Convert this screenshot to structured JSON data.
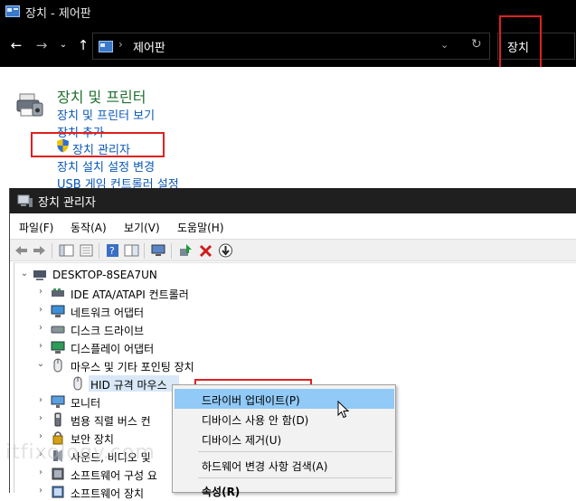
{
  "control_panel": {
    "title": "장치 - 제어판",
    "breadcrumb": "제어판",
    "search_value": "장치",
    "heading": "장치 및 프린터",
    "links": [
      "장치 및 프린터 보기",
      "장치 추가",
      "장치 관리자",
      "장치 설치 설정 변경",
      "USB 게임 컨트롤러 설정"
    ]
  },
  "device_manager": {
    "title": "장치 관리자",
    "menu": [
      "파일(F)",
      "동작(A)",
      "보기(V)",
      "도움말(H)"
    ],
    "tree": {
      "root": "DESKTOP-8SEA7UN",
      "items": [
        {
          "label": "IDE ATA/ATAPI 컨트롤러",
          "icon": "ide-controller-icon",
          "expanded": false
        },
        {
          "label": "네트워크 어댑터",
          "icon": "network-adapter-icon",
          "expanded": false
        },
        {
          "label": "디스크 드라이브",
          "icon": "disk-drive-icon",
          "expanded": false
        },
        {
          "label": "디스플레이 어댑터",
          "icon": "display-adapter-icon",
          "expanded": false
        },
        {
          "label": "마우스 및 기타 포인팅 장치",
          "icon": "mouse-icon",
          "expanded": true
        },
        {
          "label": "HID 규격 마우스",
          "icon": "mouse-icon",
          "child": true,
          "selected": true
        },
        {
          "label": "모니터",
          "icon": "monitor-icon",
          "expanded": false
        },
        {
          "label": "범용 직렬 버스 컨",
          "icon": "usb-icon",
          "expanded": false
        },
        {
          "label": "보안 장치",
          "icon": "security-device-icon",
          "expanded": false
        },
        {
          "label": "사운드, 비디오 및",
          "icon": "sound-icon",
          "expanded": false
        },
        {
          "label": "소프트웨어 구성 요",
          "icon": "software-component-icon",
          "expanded": false
        },
        {
          "label": "소프트웨어 장치",
          "icon": "software-device-icon",
          "expanded": false
        }
      ]
    },
    "context_menu": [
      "드라이버 업데이트(P)",
      "디바이스 사용 안 함(D)",
      "디바이스 제거(U)",
      "하드웨어 변경 사항 검색(A)",
      "속성(R)"
    ]
  },
  "watermark": "itfixology.com"
}
